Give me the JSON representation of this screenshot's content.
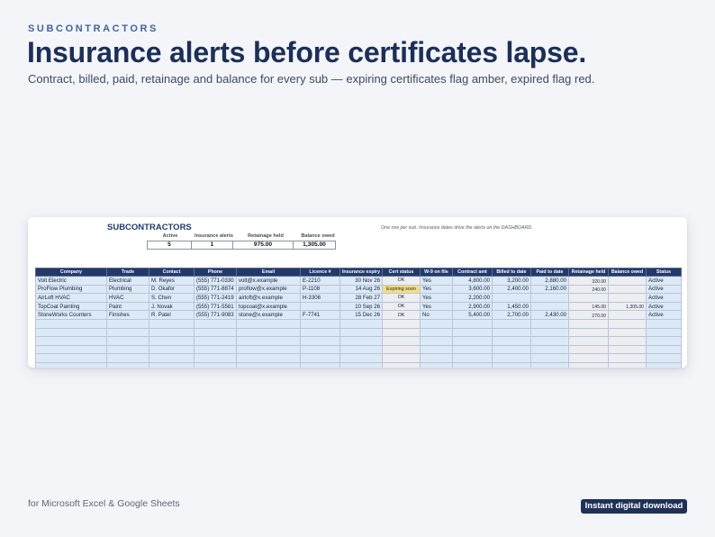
{
  "header": {
    "eyebrow": "SUBCONTRACTORS",
    "title": "Insurance alerts before certificates lapse.",
    "subtitle": "Contract, billed, paid, retainage and balance for every sub — expiring certificates flag amber, expired flag red."
  },
  "sheet": {
    "title": "SUBCONTRACTORS",
    "note": "One row per sub. Insurance dates drive the alerts on the DASHBOARD.",
    "kpis": [
      {
        "label": "Active",
        "value": "5"
      },
      {
        "label": "Insurance alerts",
        "value": "1"
      },
      {
        "label": "Retainage held",
        "value": "975.00"
      },
      {
        "label": "Balance owed",
        "value": "1,305.00"
      }
    ],
    "columns": [
      "Company",
      "Trade",
      "Contact",
      "Phone",
      "Email",
      "Licence #",
      "Insurance expiry",
      "Cert status",
      "W-9 on file",
      "Contract amt",
      "Billed to date",
      "Paid to date",
      "Retainage held",
      "Balance owed",
      "Status"
    ],
    "rows": [
      [
        "Volt Electric",
        "Electrical",
        "M. Reyes",
        "(555) 771-0330",
        "volt@x.example",
        "E-2210",
        "30 Nov 26",
        "OK",
        "Yes",
        "4,800.00",
        "3,200.00",
        "2,880.00",
        "320.00",
        "",
        "Active"
      ],
      [
        "ProFlow Plumbing",
        "Plumbing",
        "D. Okafor",
        "(555) 771-8874",
        "proflow@x.example",
        "P-1108",
        "14 Aug 26",
        "Expiring soon",
        "Yes",
        "3,600.00",
        "2,400.00",
        "2,160.00",
        "240.00",
        "",
        "Active"
      ],
      [
        "AirLoft HVAC",
        "HVAC",
        "S. Chen",
        "(555) 771-2419",
        "airloft@x.example",
        "H-3306",
        "28 Feb 27",
        "OK",
        "Yes",
        "2,200.00",
        "",
        "",
        "",
        "",
        "Active"
      ],
      [
        "TopCoat Painting",
        "Paint",
        "J. Novak",
        "(555) 771-5561",
        "topcoat@x.example",
        "",
        "10 Sep 26",
        "OK",
        "Yes",
        "2,900.00",
        "1,450.00",
        "",
        "145.00",
        "1,305.00",
        "Active"
      ],
      [
        "StoneWorks Counters",
        "Finishes",
        "R. Patel",
        "(555) 771-9083",
        "stone@x.example",
        "F-7741",
        "15 Dec 26",
        "OK",
        "No",
        "5,400.00",
        "2,700.00",
        "2,430.00",
        "270.00",
        "",
        "Active"
      ]
    ],
    "empty_rows": 6,
    "colors": {
      "header": "#22396a",
      "input_cell": "#dce9f6",
      "formula_cell": "#edeef1",
      "expiring": "#f6dd7f"
    }
  },
  "footer": {
    "platforms": "for Microsoft Excel & Google Sheets",
    "cta": "Instant digital download"
  }
}
